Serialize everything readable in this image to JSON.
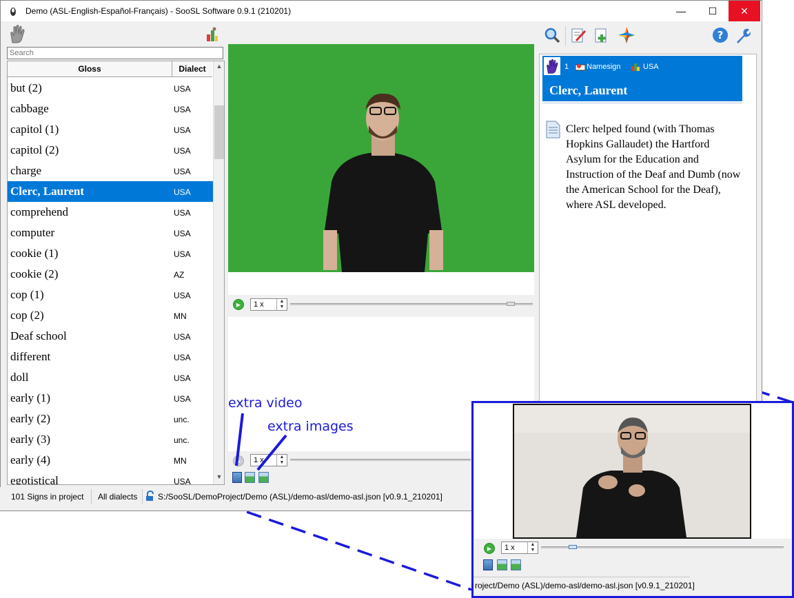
{
  "window": {
    "title": "Demo (ASL-English-Español-Français) - SooSL Software 0.9.1 (210201)",
    "minimize": "—",
    "maximize": "☐",
    "close": "✕"
  },
  "search": {
    "placeholder": "Search",
    "value": ""
  },
  "list": {
    "header_gloss": "Gloss",
    "header_dialect": "Dialect",
    "rows": [
      {
        "gloss": "but (2)",
        "dialect": "USA"
      },
      {
        "gloss": "cabbage",
        "dialect": "USA"
      },
      {
        "gloss": "capitol (1)",
        "dialect": "USA"
      },
      {
        "gloss": "capitol (2)",
        "dialect": "USA"
      },
      {
        "gloss": "charge",
        "dialect": "USA"
      },
      {
        "gloss": "Clerc, Laurent",
        "dialect": "USA",
        "selected": true
      },
      {
        "gloss": "comprehend",
        "dialect": "USA"
      },
      {
        "gloss": "computer",
        "dialect": "USA"
      },
      {
        "gloss": "cookie (1)",
        "dialect": "USA"
      },
      {
        "gloss": "cookie (2)",
        "dialect": "AZ"
      },
      {
        "gloss": "cop (1)",
        "dialect": "USA"
      },
      {
        "gloss": "cop (2)",
        "dialect": "MN"
      },
      {
        "gloss": "Deaf school",
        "dialect": "USA"
      },
      {
        "gloss": "different",
        "dialect": "USA"
      },
      {
        "gloss": "doll",
        "dialect": "USA"
      },
      {
        "gloss": "early (1)",
        "dialect": "USA"
      },
      {
        "gloss": "early (2)",
        "dialect": "unc."
      },
      {
        "gloss": "early (3)",
        "dialect": "unc."
      },
      {
        "gloss": "early (4)",
        "dialect": "MN"
      },
      {
        "gloss": "egotistical",
        "dialect": "USA"
      }
    ]
  },
  "player": {
    "speed": "1 x",
    "extra_speed": "1 x"
  },
  "detail": {
    "sense_number": "1",
    "sign_type": "Namesign",
    "dialect": "USA",
    "gloss": "Clerc, Laurent",
    "note": "Clerc helped found (with Thomas Hopkins Gallaudet) the Hartford Asylum for the Education and Instruction of the Deaf and Dumb (now the American School for the Deaf), where ASL developed."
  },
  "status": {
    "signs_count": "101 Signs in project",
    "dialects": "All dialects",
    "path": "S:/SooSL/DemoProject/Demo (ASL)/demo-asl/demo-asl.json [v0.9.1_210201]"
  },
  "annotations": {
    "extra_video": "extra video",
    "extra_images": "extra images"
  },
  "inset": {
    "speed": "1 x",
    "path": "roject/Demo (ASL)/demo-asl/demo-asl.json [v0.9.1_210201]"
  },
  "colors": {
    "selection": "#0078d7",
    "green_screen": "#3aa63a",
    "annotation_blue": "#1a1adc",
    "close_red": "#e81123"
  },
  "icons": [
    "hand-icon",
    "sort-icon",
    "search-icon",
    "edit-icon",
    "add-sign-icon",
    "compass-icon",
    "help-icon",
    "wrench-icon",
    "note-icon",
    "lock-icon",
    "play-icon",
    "film-icon",
    "image-icon"
  ]
}
